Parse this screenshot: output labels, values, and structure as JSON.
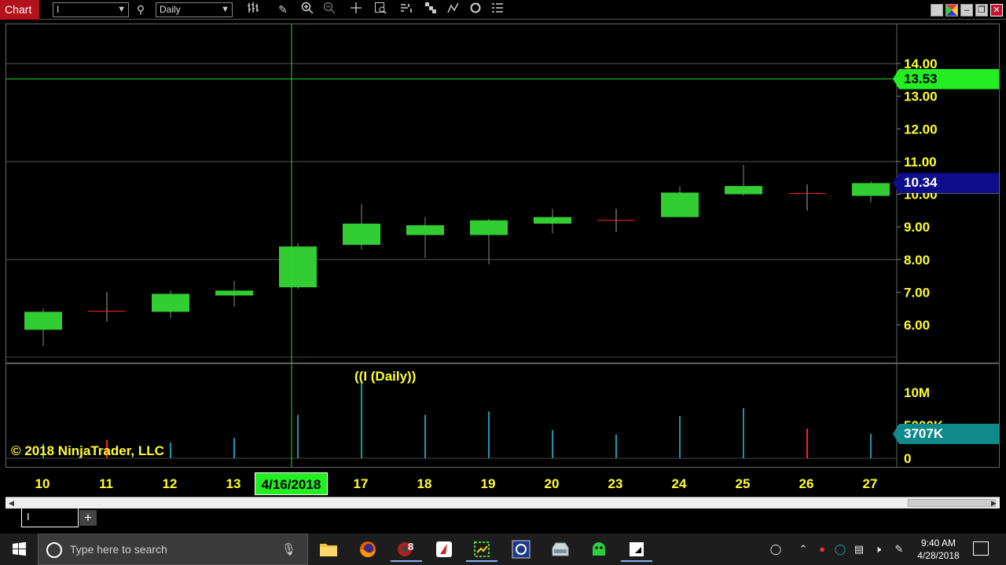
{
  "toolbar": {
    "chart_tab": "Chart",
    "instrument_value": "I",
    "interval_value": "Daily",
    "icons": [
      "bars-type-icon",
      "pencil-icon",
      "zoom-in-icon",
      "zoom-out-icon",
      "crosshair-icon",
      "data-box-icon",
      "strategies-icon",
      "indicators-icon",
      "drawing-tools-icon",
      "reload-icon",
      "properties-icon"
    ]
  },
  "window_controls": {
    "colors_icon": "color-picker-icon",
    "minimize": "–",
    "restore": "❐",
    "close": "✕"
  },
  "chart": {
    "copyright": "© 2018 NinjaTrader, LLC",
    "volume_label": "((I (Daily))",
    "crosshair_price_label": "13.53",
    "last_price_label": "10.34",
    "volume_marker_label": "3707K",
    "crosshair_date_label": "4/16/2018",
    "colors": {
      "up": "#32cd32",
      "down": "#ff2020",
      "axis_text": "#ffff2b",
      "volume": "#1a9aa6",
      "crosshair": "#22dd22",
      "last_price_bg": "#0e0e8a",
      "volume_marker_bg": "#0e8a8a",
      "crosshair_tag_bg": "#22ee22"
    }
  },
  "chart_data": {
    "type": "candlestick",
    "x_tick_labels": [
      "10",
      "11",
      "12",
      "13",
      "4/16/2018",
      "17",
      "18",
      "19",
      "20",
      "23",
      "24",
      "25",
      "26",
      "27"
    ],
    "price_axis": {
      "ticks": [
        6.0,
        7.0,
        8.0,
        9.0,
        10.0,
        11.0,
        12.0,
        13.0,
        14.0
      ],
      "tick_labels": [
        "6.00",
        "7.00",
        "8.00",
        "9.00",
        "10.00",
        "11.00",
        "12.00",
        "13.00",
        "14.00"
      ],
      "range": [
        5.0,
        15.0
      ]
    },
    "volume_axis": {
      "tick_labels": [
        "10M",
        "5000K",
        "0"
      ],
      "ticks": [
        10000000,
        5000000,
        0
      ],
      "range": [
        0,
        12000000
      ]
    },
    "candles": [
      {
        "date": "10",
        "open": 5.85,
        "high": 6.5,
        "low": 5.35,
        "close": 6.4
      },
      {
        "date": "11",
        "open": 6.42,
        "high": 7.0,
        "low": 6.1,
        "close": 6.42
      },
      {
        "date": "12",
        "open": 6.4,
        "high": 7.05,
        "low": 6.2,
        "close": 6.95
      },
      {
        "date": "13",
        "open": 6.9,
        "high": 7.35,
        "low": 6.55,
        "close": 7.05
      },
      {
        "date": "4/16/2018",
        "open": 7.15,
        "high": 8.5,
        "low": 7.1,
        "close": 8.4
      },
      {
        "date": "17",
        "open": 8.45,
        "high": 9.7,
        "low": 8.3,
        "close": 9.1
      },
      {
        "date": "18",
        "open": 8.75,
        "high": 9.3,
        "low": 8.05,
        "close": 9.05
      },
      {
        "date": "19",
        "open": 8.75,
        "high": 9.25,
        "low": 7.85,
        "close": 9.2
      },
      {
        "date": "20",
        "open": 9.1,
        "high": 9.55,
        "low": 8.8,
        "close": 9.3
      },
      {
        "date": "23",
        "open": 9.2,
        "high": 9.55,
        "low": 8.85,
        "close": 9.2
      },
      {
        "date": "24",
        "open": 9.3,
        "high": 10.25,
        "low": 9.3,
        "close": 10.05
      },
      {
        "date": "25",
        "open": 10.0,
        "high": 10.9,
        "low": 9.95,
        "close": 10.25
      },
      {
        "date": "26",
        "open": 10.02,
        "high": 10.3,
        "low": 9.5,
        "close": 10.02
      },
      {
        "date": "27",
        "open": 9.95,
        "high": 10.4,
        "low": 9.75,
        "close": 10.34
      }
    ],
    "volumes": [
      {
        "date": "10",
        "value": 2200000,
        "direction": "up"
      },
      {
        "date": "11",
        "value": 2800000,
        "direction": "down"
      },
      {
        "date": "12",
        "value": 2400000,
        "direction": "up"
      },
      {
        "date": "13",
        "value": 3100000,
        "direction": "up"
      },
      {
        "date": "4/16/2018",
        "value": 6600000,
        "direction": "up"
      },
      {
        "date": "17",
        "value": 11500000,
        "direction": "up"
      },
      {
        "date": "18",
        "value": 6600000,
        "direction": "up"
      },
      {
        "date": "19",
        "value": 7100000,
        "direction": "up"
      },
      {
        "date": "20",
        "value": 4300000,
        "direction": "up"
      },
      {
        "date": "23",
        "value": 3600000,
        "direction": "up"
      },
      {
        "date": "24",
        "value": 6400000,
        "direction": "up"
      },
      {
        "date": "25",
        "value": 7600000,
        "direction": "up"
      },
      {
        "date": "26",
        "value": 4500000,
        "direction": "down"
      },
      {
        "date": "27",
        "value": 3707000,
        "direction": "up"
      }
    ],
    "crosshair": {
      "date": "4/16/2018",
      "price": 13.53
    },
    "last_price": 10.34,
    "grid": true
  },
  "tabs": {
    "instrument_tab": "I",
    "add_tab": "+"
  },
  "taskbar": {
    "search_placeholder": "Type here to search",
    "apps": [
      "file-explorer-icon",
      "firefox-icon",
      "tasks-badge-icon",
      "app-red-icon",
      "app-green-icon",
      "app-satellite-icon",
      "app-drive-icon",
      "app-android-icon",
      "ninjatrader-icon"
    ],
    "app_badge": "8",
    "time": "9:40 AM",
    "date": "4/28/2018"
  }
}
